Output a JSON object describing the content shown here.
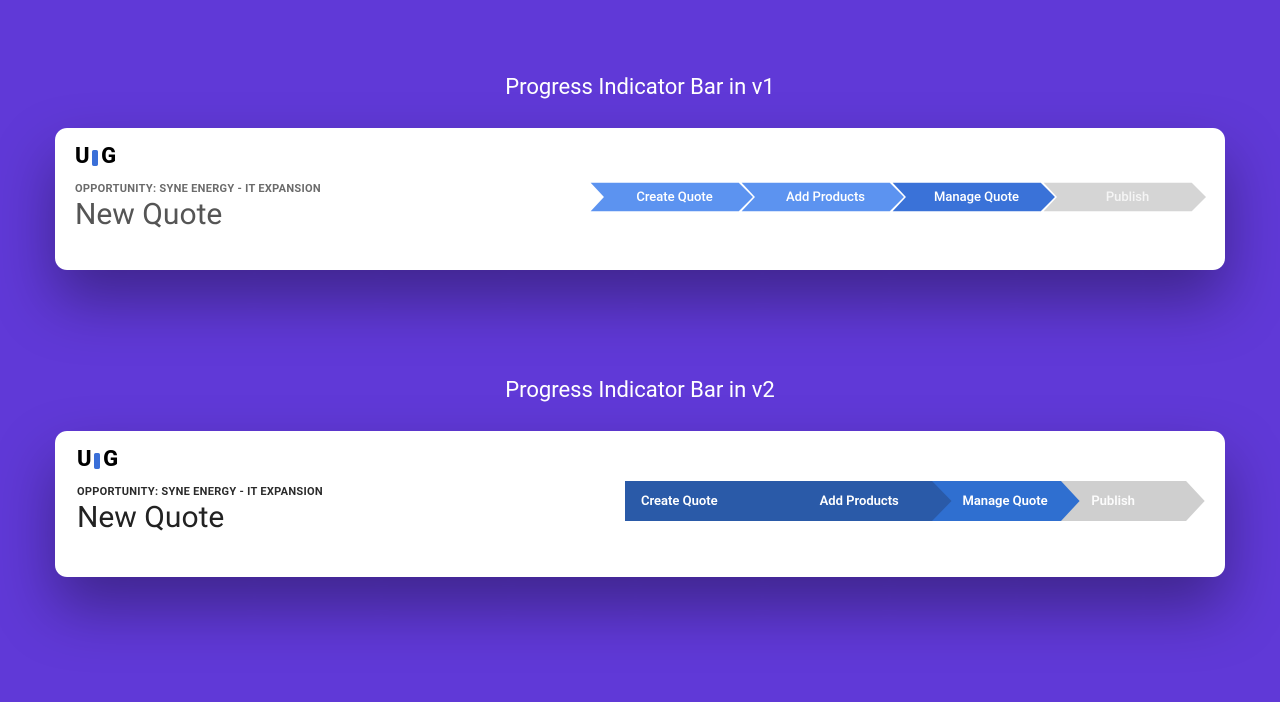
{
  "sections": {
    "v1_title": "Progress Indicator Bar in v1",
    "v2_title": "Progress Indicator Bar in v2"
  },
  "header": {
    "opportunity_label": "OPPORTUNITY: SYNE ENERGY - IT EXPANSION",
    "page_title": "New Quote"
  },
  "logo": {
    "letter_u": "U",
    "letter_g": "G"
  },
  "progress": {
    "steps": [
      {
        "label": "Create Quote"
      },
      {
        "label": "Add Products"
      },
      {
        "label": "Manage Quote"
      },
      {
        "label": "Publish"
      }
    ]
  },
  "colors": {
    "v1_completed": "#5c93f0",
    "v1_current": "#3a72d8",
    "v1_disabled": "#d5d5d5",
    "v2_completed": "#2a5aa8",
    "v2_current": "#2f6fd0",
    "v2_disabled": "#cfcfcf"
  }
}
